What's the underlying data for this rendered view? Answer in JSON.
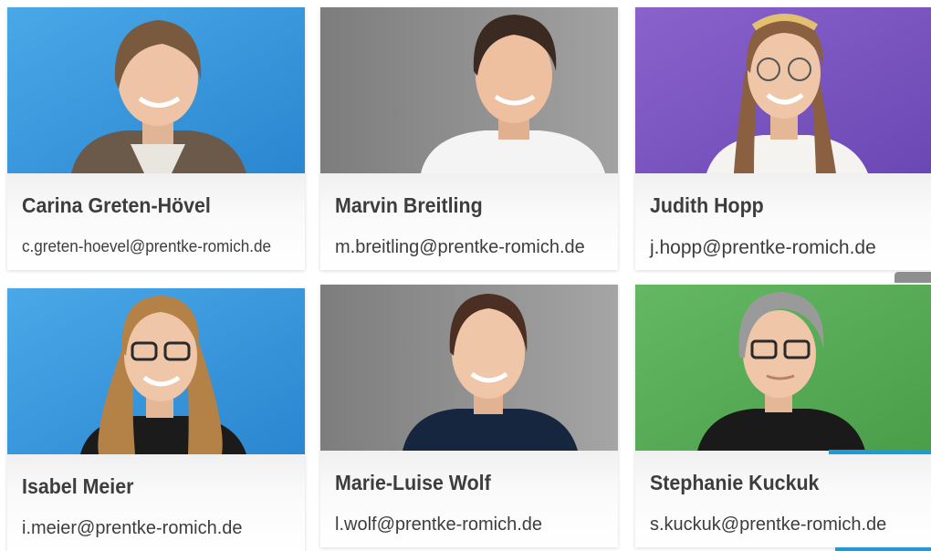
{
  "team": [
    {
      "name": "Carina Greten-Hövel",
      "email": "c.greten-hoevel@prentke-romich.de",
      "bg": "#3c9ee0"
    },
    {
      "name": "Marvin Breitling",
      "email": "m.breitling@prentke-romich.de",
      "bg": "#8e8e8e"
    },
    {
      "name": "Judith Hopp",
      "email": "j.hopp@prentke-romich.de",
      "bg": "#7a55c0"
    },
    {
      "name": "Isabel Meier",
      "email": "i.meier@prentke-romich.de",
      "bg": "#3c9ee0"
    },
    {
      "name": "Marie-Luise Wolf",
      "email": "l.wolf@prentke-romich.de",
      "bg": "#8e8e8e"
    },
    {
      "name": "Stephanie Kuckuk",
      "email": "s.kuckuk@prentke-romich.de",
      "bg": "#5aae5a"
    }
  ],
  "colors": {
    "accent": "#1e9ad6",
    "text": "#3d3d3d"
  }
}
